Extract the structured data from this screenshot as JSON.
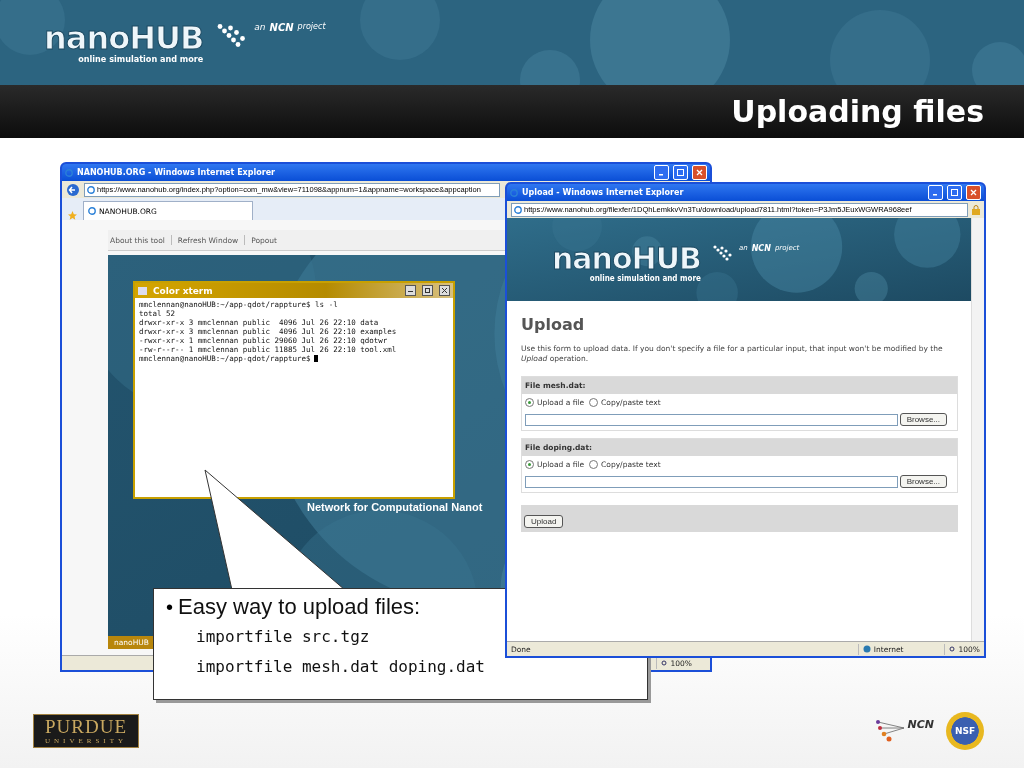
{
  "header": {
    "logo": "nanoHUB",
    "tagline": "online simulation and more",
    "project_prefix": "an",
    "project_name": "NCN",
    "project_suffix": "project"
  },
  "slide_title": "Uploading files",
  "main_browser": {
    "title": "NANOHUB.ORG - Windows Internet Explorer",
    "url": "https://www.nanohub.org/index.php?option=com_mw&view=711098&appnum=1&appname=workspace&appcaption",
    "tab": "NANOHUB.ORG",
    "links": [
      "About this tool",
      "Refresh Window",
      "Popout"
    ],
    "banner_text": "Network for Computational Nanot",
    "footer_logo": "nanoHUB",
    "zoom": "100%"
  },
  "xterm": {
    "title": "Color xterm",
    "lines": [
      "mmclennan@nanoHUB:~/app-qdot/rappture$ ls -l",
      "total 52",
      "drwxr-xr-x 3 mmclennan public  4096 Jul 26 22:10 data",
      "drwxr-xr-x 3 mmclennan public  4096 Jul 26 22:10 examples",
      "-rwxr-xr-x 1 mmclennan public 29060 Jul 26 22:10 qdotwr",
      "-rw-r--r-- 1 mmclennan public 11885 Jul 26 22:10 tool.xml",
      "mmclennan@nanoHUB:~/app-qdot/rappture$"
    ]
  },
  "upload_window": {
    "title": "Upload - Windows Internet Explorer",
    "url": "https://www.nanohub.org/filexfer/1DQhLemkkvVn3Tu/download/upload7811.html?token=P3Jm5JEuxWGWRA968eef",
    "logo": "nanoHUB",
    "tagline": "online simulation and more",
    "project_prefix": "an",
    "project_name": "NCN",
    "project_suffix": "project",
    "heading": "Upload",
    "intro": "Use this form to upload data. If you don't specify a file for a particular input, that input won't be modified by the *Upload* operation.",
    "files": [
      {
        "label": "File mesh.dat:",
        "options": [
          {
            "label": "Upload a file",
            "selected": true
          },
          {
            "label": "Copy/paste text",
            "selected": false
          }
        ],
        "browse": "Browse..."
      },
      {
        "label": "File doping.dat:",
        "options": [
          {
            "label": "Upload a file",
            "selected": true
          },
          {
            "label": "Copy/paste text",
            "selected": false
          }
        ],
        "browse": "Browse..."
      }
    ],
    "submit": "Upload",
    "status": "Done",
    "zone": "Internet",
    "zoom": "100%"
  },
  "callout": {
    "bullet": "•",
    "text": "Easy way to upload files:",
    "commands": [
      "importfile src.tgz",
      "importfile mesh.dat doping.dat"
    ]
  },
  "footer": {
    "university": "PURDUE",
    "university_sub": "UNIVERSITY",
    "ncn": "NCN",
    "nsf": "NSF"
  }
}
